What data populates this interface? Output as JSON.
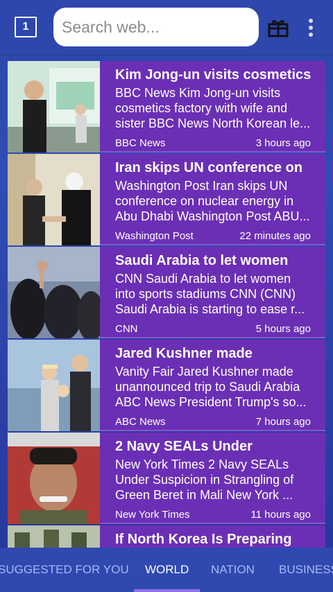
{
  "toolbar": {
    "tab_count": "1",
    "search_placeholder": "Search web..."
  },
  "articles": [
    {
      "title": "Kim Jong-un visits cosmetics",
      "snippet": "BBC News Kim Jong-un visits cosmetics factory with wife and sister BBC News North Korean le...",
      "source": "BBC News",
      "time": "3 hours ago"
    },
    {
      "title": "Iran skips UN conference on",
      "snippet": "Washington Post Iran skips UN conference on nuclear energy in Abu Dhabi Washington Post ABU...",
      "source": "Washington Post",
      "time": "22 minutes ago"
    },
    {
      "title": "Saudi Arabia to let women",
      "snippet": "CNN Saudi Arabia to let women into sports stadiums CNN (CNN) Saudi Arabia is starting to ease r...",
      "source": "CNN",
      "time": "5 hours ago"
    },
    {
      "title": "Jared Kushner made",
      "snippet": "Vanity Fair Jared Kushner made unannounced trip to Saudi Arabia ABC News President Trump's so...",
      "source": "ABC News",
      "time": "7 hours ago"
    },
    {
      "title": "2 Navy SEALs Under",
      "snippet": "New York Times 2 Navy SEALs Under Suspicion in Strangling of Green Beret in Mali New York ...",
      "source": "New York Times",
      "time": "11 hours ago"
    },
    {
      "title": "If North Korea Is Preparing",
      "snippet": "",
      "source": "",
      "time": ""
    }
  ],
  "tabs": [
    {
      "label": "SUGGESTED FOR YOU",
      "active": false
    },
    {
      "label": "WORLD",
      "active": true
    },
    {
      "label": "NATION",
      "active": false
    },
    {
      "label": "BUSINESS",
      "active": false
    }
  ],
  "colors": {
    "card_background": "#6b2fb5",
    "toolbar_background": "#2e47ad",
    "tab_indicator": "#8f72e8"
  }
}
